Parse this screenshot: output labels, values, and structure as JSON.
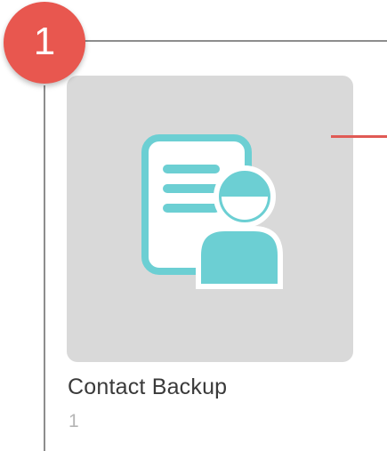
{
  "step_badge": {
    "number": "1",
    "color": "#e8574f"
  },
  "app": {
    "name": "Contact Backup",
    "count": "1",
    "icon": "contact-backup-icon",
    "icon_color": "#6ccfd3",
    "tile_color": "#d9d9d9"
  },
  "pointer": {
    "color": "#e05a55"
  }
}
